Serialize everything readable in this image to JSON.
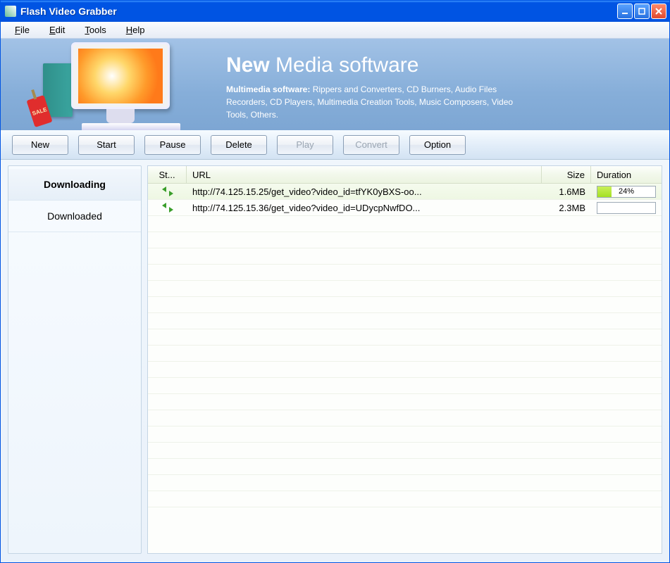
{
  "window": {
    "title": "Flash Video Grabber"
  },
  "menu": {
    "file": "File",
    "edit": "Edit",
    "tools": "Tools",
    "help": "Help"
  },
  "banner": {
    "title_bold": "New",
    "title_rest": "Media software",
    "desc_label": "Multimedia software:",
    "desc_rest": " Rippers and Converters, CD Burners, Audio Files Recorders, CD Players,  Multimedia Creation Tools, Music Composers, Video Tools, Others.",
    "sale": "SALE"
  },
  "toolbar": {
    "new": "New",
    "start": "Start",
    "pause": "Pause",
    "delete": "Delete",
    "play": "Play",
    "convert": "Convert",
    "option": "Option"
  },
  "sidebar": {
    "downloading": "Downloading",
    "downloaded": "Downloaded"
  },
  "list": {
    "headers": {
      "status": "St...",
      "url": "URL",
      "size": "Size",
      "duration": "Duration"
    },
    "rows": [
      {
        "url": "http://74.125.15.25/get_video?video_id=tfYK0yBXS-oo...",
        "size": "1.6MB",
        "progress_pct": 24,
        "progress_label": "24%",
        "selected": true
      },
      {
        "url": "http://74.125.15.36/get_video?video_id=UDycpNwfDO...",
        "size": "2.3MB",
        "progress_pct": 0,
        "progress_label": "",
        "selected": false
      }
    ]
  }
}
